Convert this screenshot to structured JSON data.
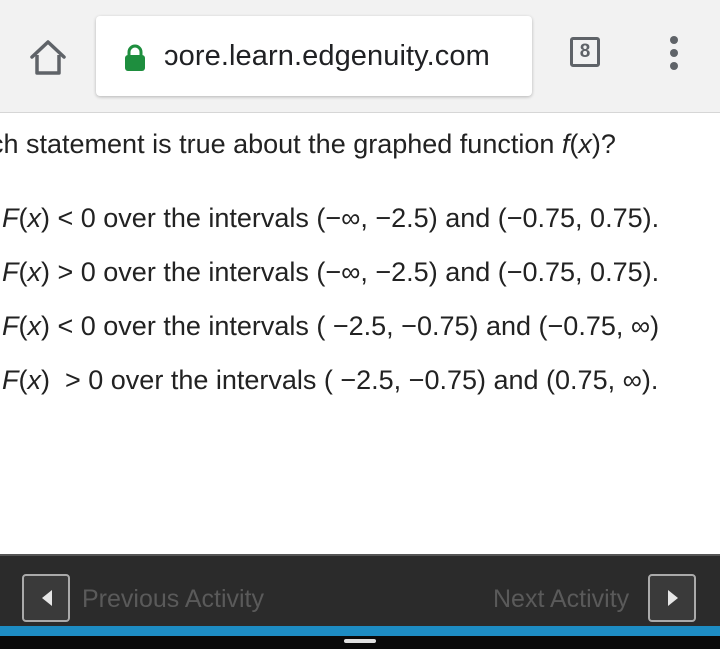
{
  "browser": {
    "url": "ɔore.learn.edgenuity.com",
    "tab_count": "8",
    "accent_colors": {
      "lock": "#1e8e3e",
      "activity_strip": "#1d8cc3"
    }
  },
  "question": {
    "text_prefix": "ch statement is true about the graphed function ",
    "func": "f",
    "var": "x",
    "text_suffix": "?"
  },
  "options": [
    {
      "func": "F",
      "var": "x",
      "rest": " < 0 over the intervals (−∞, −2.5) and (−0.75, 0.75)."
    },
    {
      "func": "F",
      "var": "x",
      "rest": " > 0 over the intervals (−∞, −2.5) and (−0.75, 0.75)."
    },
    {
      "func": "F",
      "var": "x",
      "rest": " < 0 over the intervals ( −2.5, −0.75) and (−0.75, ∞)"
    },
    {
      "func": "F",
      "var": "x",
      "rest": "  > 0 over the intervals ( −2.5, −0.75) and (0.75, ∞)."
    }
  ],
  "activity_nav": {
    "previous_label": "Previous Activity",
    "next_label": "Next Activity"
  }
}
